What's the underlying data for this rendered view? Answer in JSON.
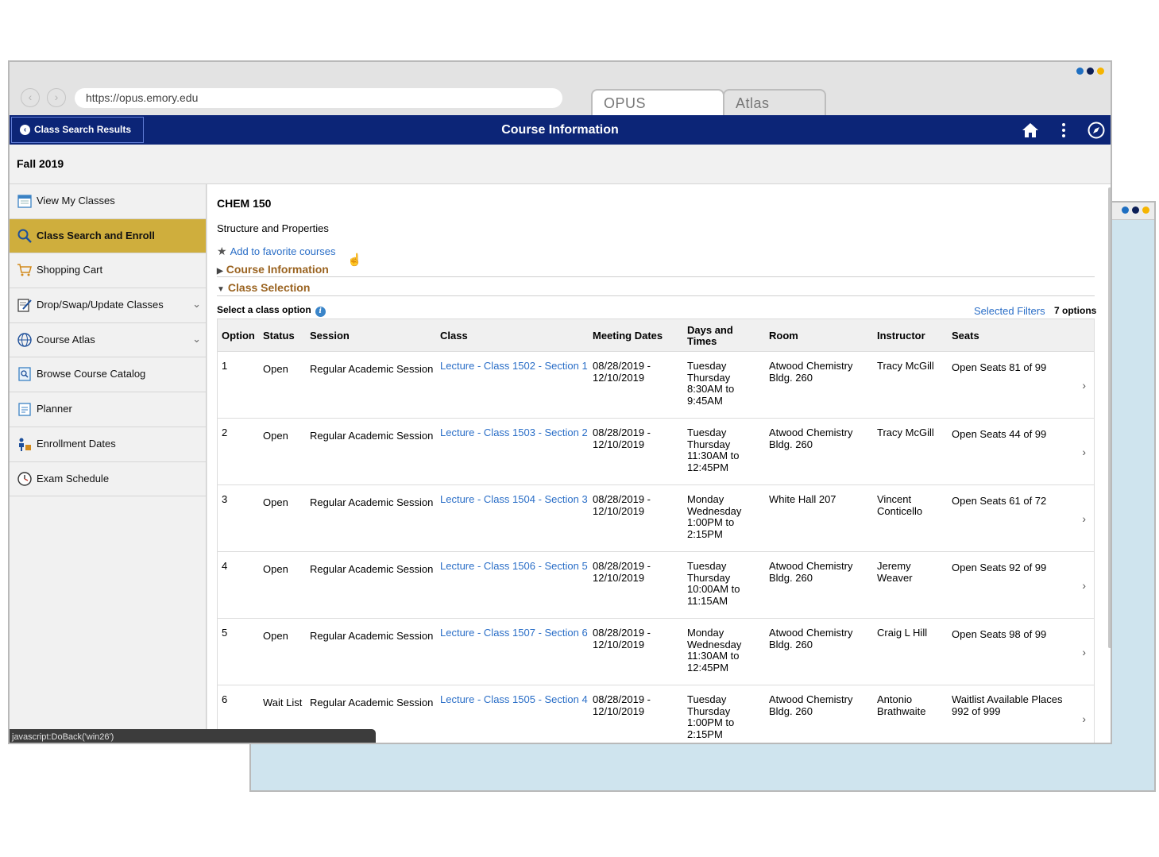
{
  "colors": {
    "navy": "#0c2577",
    "active_gold": "#cfae3d",
    "link_blue": "#2a6ec7",
    "section_brown": "#9a6320",
    "dot_blue": "#1f6fc1",
    "dot_navy": "#0c1f57",
    "dot_gold": "#f5b400"
  },
  "browser": {
    "url": "https://opus.emory.edu",
    "tabs": [
      {
        "label": "OPUS",
        "active": true
      },
      {
        "label": "Atlas",
        "active": false
      }
    ]
  },
  "header": {
    "back_label": "Class Search Results",
    "title": "Course Information",
    "icons": [
      "home-icon",
      "more-vertical-icon",
      "compass-icon"
    ]
  },
  "term": "Fall 2019",
  "sidebar": {
    "items": [
      {
        "label": "View My Classes",
        "icon": "calendar-icon",
        "active": false,
        "expandable": false
      },
      {
        "label": "Class Search and Enroll",
        "icon": "search-icon",
        "active": true,
        "expandable": false
      },
      {
        "label": "Shopping Cart",
        "icon": "cart-icon",
        "active": false,
        "expandable": false
      },
      {
        "label": "Drop/Swap/Update Classes",
        "icon": "edit-document-icon",
        "active": false,
        "expandable": true
      },
      {
        "label": "Course Atlas",
        "icon": "globe-icon",
        "active": false,
        "expandable": true
      },
      {
        "label": "Browse Course Catalog",
        "icon": "catalog-icon",
        "active": false,
        "expandable": false
      },
      {
        "label": "Planner",
        "icon": "planner-icon",
        "active": false,
        "expandable": false
      },
      {
        "label": "Enrollment Dates",
        "icon": "enrollment-dates-icon",
        "active": false,
        "expandable": false
      },
      {
        "label": "Exam Schedule",
        "icon": "clock-icon",
        "active": false,
        "expandable": false
      }
    ]
  },
  "course": {
    "code": "CHEM 150",
    "title": "Structure and Properties",
    "favorite_label": "Add to favorite courses",
    "section_info": "Course Information",
    "section_selection": "Class Selection",
    "select_label": "Select a class option",
    "filters_label": "Selected Filters",
    "options_count": "7 options"
  },
  "table": {
    "headers": {
      "option": "Option",
      "status": "Status",
      "session": "Session",
      "class": "Class",
      "meeting": "Meeting Dates",
      "days_1": "Days and",
      "days_2": "Times",
      "room": "Room",
      "instructor": "Instructor",
      "seats": "Seats"
    },
    "rows": [
      {
        "option": "1",
        "status": "Open",
        "session": "Regular Academic Session",
        "class": "Lecture - Class 1502 - Section 1",
        "date_1": "08/28/2019 -",
        "date_2": "12/10/2019",
        "days_1": "Tuesday",
        "days_2": "Thursday",
        "time_1": "8:30AM to",
        "time_2": "9:45AM",
        "room_1": "Atwood Chemistry",
        "room_2": "Bldg. 260",
        "instr_1": "Tracy McGill",
        "instr_2": "",
        "seats_1": "Open Seats 81 of 99",
        "seats_2": ""
      },
      {
        "option": "2",
        "status": "Open",
        "session": "Regular Academic Session",
        "class": "Lecture - Class 1503 - Section 2",
        "date_1": "08/28/2019 -",
        "date_2": "12/10/2019",
        "days_1": "Tuesday",
        "days_2": "Thursday",
        "time_1": "11:30AM to",
        "time_2": "12:45PM",
        "room_1": "Atwood Chemistry",
        "room_2": "Bldg. 260",
        "instr_1": "Tracy McGill",
        "instr_2": "",
        "seats_1": "Open Seats 44 of 99",
        "seats_2": ""
      },
      {
        "option": "3",
        "status": "Open",
        "session": "Regular Academic Session",
        "class": "Lecture - Class 1504 - Section 3",
        "date_1": "08/28/2019 -",
        "date_2": "12/10/2019",
        "days_1": "Monday",
        "days_2": "Wednesday",
        "time_1": "1:00PM to",
        "time_2": "2:15PM",
        "room_1": "White Hall 207",
        "room_2": "",
        "instr_1": "Vincent",
        "instr_2": "Conticello",
        "seats_1": "Open Seats 61 of 72",
        "seats_2": ""
      },
      {
        "option": "4",
        "status": "Open",
        "session": "Regular Academic Session",
        "class": "Lecture - Class 1506 - Section 5",
        "date_1": "08/28/2019 -",
        "date_2": "12/10/2019",
        "days_1": "Tuesday",
        "days_2": "Thursday",
        "time_1": "10:00AM to",
        "time_2": "11:15AM",
        "room_1": "Atwood Chemistry",
        "room_2": "Bldg. 260",
        "instr_1": "Jeremy",
        "instr_2": "Weaver",
        "seats_1": "Open Seats 92 of 99",
        "seats_2": ""
      },
      {
        "option": "5",
        "status": "Open",
        "session": "Regular Academic Session",
        "class": "Lecture - Class 1507 - Section 6",
        "date_1": "08/28/2019 -",
        "date_2": "12/10/2019",
        "days_1": "Monday",
        "days_2": "Wednesday",
        "time_1": "11:30AM to",
        "time_2": "12:45PM",
        "room_1": "Atwood Chemistry",
        "room_2": "Bldg. 260",
        "instr_1": "Craig L Hill",
        "instr_2": "",
        "seats_1": "Open Seats 98 of 99",
        "seats_2": ""
      },
      {
        "option": "6",
        "status": "Wait List",
        "session": "Regular Academic Session",
        "class": "Lecture - Class 1505 - Section 4",
        "date_1": "08/28/2019 -",
        "date_2": "12/10/2019",
        "days_1": "Tuesday",
        "days_2": "Thursday",
        "time_1": "1:00PM to",
        "time_2": "2:15PM",
        "room_1": "Atwood Chemistry",
        "room_2": "Bldg. 260",
        "instr_1": "Antonio",
        "instr_2": "Brathwaite",
        "seats_1": "Waitlist Available Places",
        "seats_2": "992 of 999"
      }
    ]
  },
  "status_bar": "javascript:DoBack('win26')"
}
